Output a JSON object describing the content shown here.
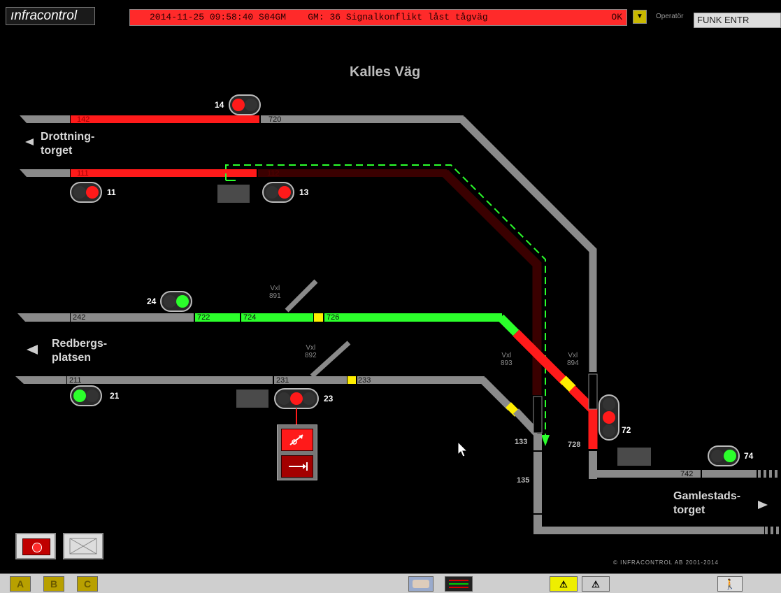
{
  "header": {
    "logo": "ınfracontrol",
    "alarm_text": "2014-11-25 09:58:40 S04GM    GM: 36 Signalkonflikt låst tågväg",
    "alarm_ok": "OK",
    "operator_label": "Operatör",
    "operator_value": "FUNK ENTR"
  },
  "map": {
    "title": "Kalles Väg",
    "stations": {
      "drottningtorget_1": "Drottning-",
      "drottningtorget_2": "torget",
      "redbergsplatsen_1": "Redbergs-",
      "redbergsplatsen_2": "platsen",
      "gamlestadstorget_1": "Gamlestads-",
      "gamlestadstorget_2": "torget"
    },
    "segments": {
      "s142": "142",
      "s720": "720",
      "s111": "111",
      "s112": "112",
      "s242": "242",
      "s722": "722",
      "s724": "724",
      "s726": "726",
      "s211": "211",
      "s231": "231",
      "s233": "233",
      "s133": "133",
      "s135": "135",
      "s728": "728",
      "s742": "742"
    },
    "signals": {
      "sig14": "14",
      "sig11": "11",
      "sig13": "13",
      "sig24": "24",
      "sig21": "21",
      "sig23": "23",
      "sig72": "72",
      "sig74": "74"
    },
    "switches": {
      "vxl891_a": "Vxl",
      "vxl891_b": "891",
      "vxl892_a": "Vxl",
      "vxl892_b": "892",
      "vxl893_a": "Vxl",
      "vxl893_b": "893",
      "vxl894_a": "Vxl",
      "vxl894_b": "894"
    },
    "copyright": "© INFRACONTROL AB 2001-2014"
  },
  "bottom": {
    "btn_a": "A",
    "btn_b": "B",
    "btn_c": "C"
  },
  "colors": {
    "track_idle": "#8a8a8a",
    "occupied": "#ff1a1a",
    "route": "#2bff2b",
    "locked": "#3a0000",
    "switch_pos": "#ffee00"
  }
}
